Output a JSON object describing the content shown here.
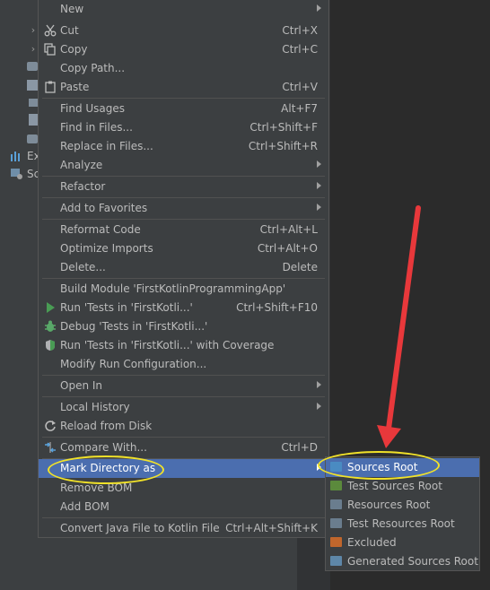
{
  "colors": {
    "menu_bg": "#3c3f41",
    "selection": "#4b6eaf",
    "editor_bg": "#2b2b2b",
    "annotation_red": "#e8383b",
    "annotation_yellow": "#f1e229"
  },
  "project_tree": {
    "items": [
      {
        "label": "Ex",
        "icon": "bar-chart-icon"
      },
      {
        "label": "Sc",
        "icon": "scratch-icon"
      }
    ]
  },
  "context_menu": {
    "new": {
      "label": "New"
    },
    "cut": {
      "label": "Cut",
      "shortcut": "Ctrl+X",
      "icon": "scissors-icon"
    },
    "copy": {
      "label": "Copy",
      "shortcut": "Ctrl+C",
      "icon": "copy-icon"
    },
    "copy_path": {
      "label": "Copy Path..."
    },
    "paste": {
      "label": "Paste",
      "shortcut": "Ctrl+V",
      "icon": "clipboard-icon"
    },
    "find_usages": {
      "label": "Find Usages",
      "shortcut": "Alt+F7"
    },
    "find_in_files": {
      "label": "Find in Files...",
      "shortcut": "Ctrl+Shift+F"
    },
    "replace_in_files": {
      "label": "Replace in Files...",
      "shortcut": "Ctrl+Shift+R"
    },
    "analyze": {
      "label": "Analyze"
    },
    "refactor": {
      "label": "Refactor"
    },
    "add_to_favorites": {
      "label": "Add to Favorites"
    },
    "reformat_code": {
      "label": "Reformat Code",
      "shortcut": "Ctrl+Alt+L"
    },
    "optimize_imports": {
      "label": "Optimize Imports",
      "shortcut": "Ctrl+Alt+O"
    },
    "delete": {
      "label": "Delete...",
      "shortcut": "Delete"
    },
    "build_module": {
      "label": "Build Module 'FirstKotlinProgrammingApp'"
    },
    "run_tests": {
      "label": "Run 'Tests in 'FirstKotli...'",
      "shortcut": "Ctrl+Shift+F10",
      "icon": "run-icon"
    },
    "debug_tests": {
      "label": "Debug 'Tests in 'FirstKotli...'",
      "icon": "debug-icon"
    },
    "run_coverage": {
      "label": "Run 'Tests in 'FirstKotli...' with Coverage",
      "icon": "coverage-icon"
    },
    "modify_run": {
      "label": "Modify Run Configuration..."
    },
    "open_in": {
      "label": "Open In"
    },
    "local_history": {
      "label": "Local History"
    },
    "reload_from_disk": {
      "label": "Reload from Disk",
      "icon": "reload-icon"
    },
    "compare_with": {
      "label": "Compare With...",
      "shortcut": "Ctrl+D",
      "icon": "compare-icon"
    },
    "mark_directory_as": {
      "label": "Mark Directory as"
    },
    "remove_bom": {
      "label": "Remove BOM"
    },
    "add_bom": {
      "label": "Add BOM"
    },
    "convert_java": {
      "label": "Convert Java File to Kotlin File",
      "shortcut": "Ctrl+Alt+Shift+K"
    }
  },
  "submenu": {
    "items": [
      {
        "label": "Sources Root",
        "icon": "sources-root-icon",
        "color": "#4a8bc2"
      },
      {
        "label": "Test Sources Root",
        "icon": "test-sources-root-icon",
        "color": "#5b8a3c"
      },
      {
        "label": "Resources Root",
        "icon": "resources-root-icon",
        "color": "#6a7d8e"
      },
      {
        "label": "Test Resources Root",
        "icon": "test-resources-root-icon",
        "color": "#6a7d8e"
      },
      {
        "label": "Excluded",
        "icon": "excluded-folder-icon",
        "color": "#c0662c"
      },
      {
        "label": "Generated Sources Root",
        "icon": "generated-sources-root-icon",
        "color": "#5e87a8"
      }
    ]
  }
}
